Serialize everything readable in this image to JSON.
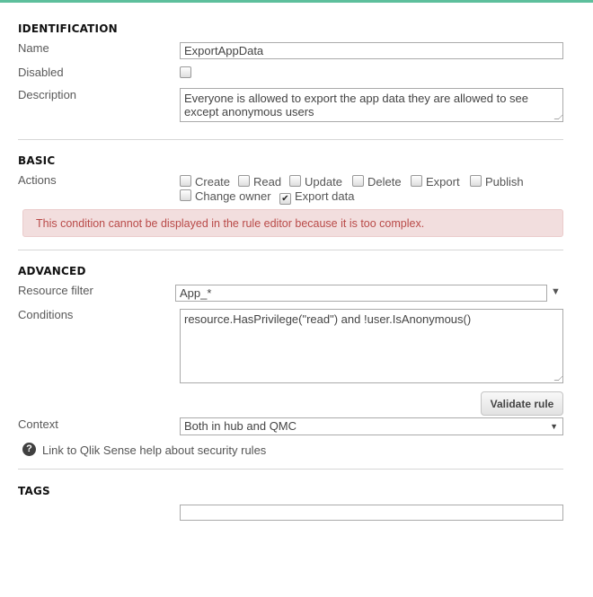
{
  "identification": {
    "heading": "IDENTIFICATION",
    "name_label": "Name",
    "name_value": "ExportAppData",
    "disabled_label": "Disabled",
    "disabled_checked": false,
    "description_label": "Description",
    "description_value": "Everyone is allowed to export the app data they are allowed to see except anonymous users"
  },
  "basic": {
    "heading": "BASIC",
    "actions_label": "Actions",
    "actions": [
      {
        "label": "Create",
        "checked": false
      },
      {
        "label": "Read",
        "checked": false
      },
      {
        "label": "Update",
        "checked": false
      },
      {
        "label": "Delete",
        "checked": false
      },
      {
        "label": "Export",
        "checked": false
      },
      {
        "label": "Publish",
        "checked": false
      },
      {
        "label": "Change owner",
        "checked": false
      },
      {
        "label": "Export data",
        "checked": true
      }
    ],
    "error": "This condition cannot be displayed in the rule editor because it is too complex."
  },
  "advanced": {
    "heading": "ADVANCED",
    "resource_filter_label": "Resource filter",
    "resource_filter_value": "App_*",
    "conditions_label": "Conditions",
    "conditions_value": "resource.HasPrivilege(\"read\") and !user.IsAnonymous()",
    "validate_label": "Validate rule",
    "context_label": "Context",
    "context_value": "Both in hub and QMC",
    "help_link": "Link to Qlik Sense help about security rules"
  },
  "tags": {
    "heading": "TAGS",
    "value": ""
  },
  "colors": {
    "accent": "#5dbf9c",
    "error_bg": "#f2dede",
    "error_text": "#b94a48"
  }
}
